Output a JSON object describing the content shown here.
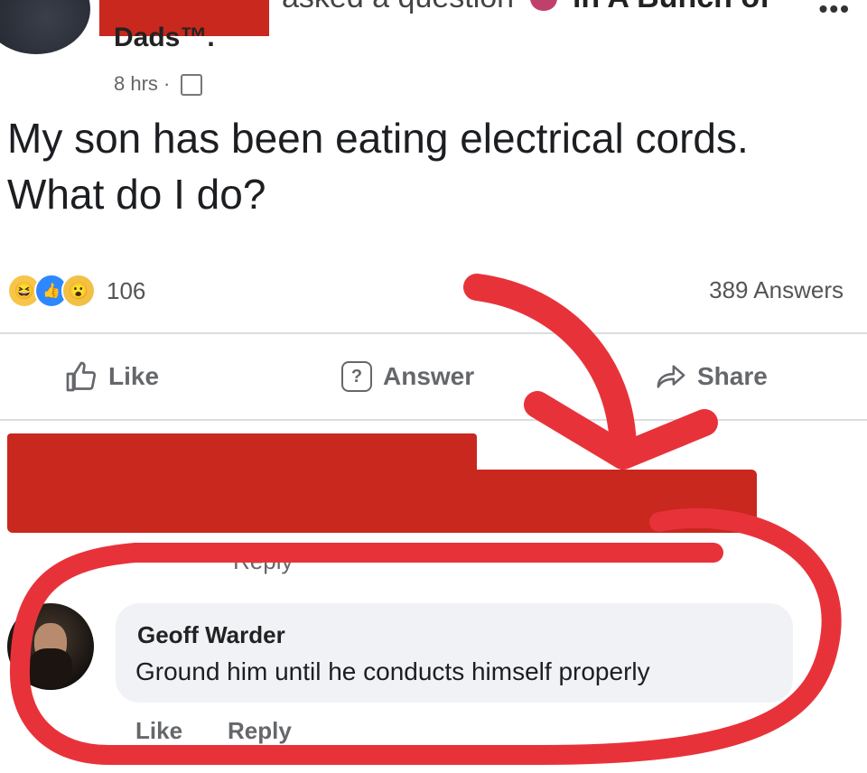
{
  "post": {
    "asked_text": "asked a question",
    "in_text": "in A Bunch of",
    "group_tail": "Dads™.",
    "time": "8 hrs ·",
    "question": "My son has been eating electrical cords. What do I do?",
    "reaction_count": "106",
    "answers_count": "389 Answers",
    "more": "•••"
  },
  "actions": {
    "like": "Like",
    "answer": "Answer",
    "share": "Share"
  },
  "partial": {
    "reply": "Reply"
  },
  "comment": {
    "author": "Geoff Warder",
    "text": "Ground him until he conducts himself properly",
    "like": "Like",
    "reply": "Reply"
  },
  "icons": {
    "reactions": [
      "haha-reaction-icon",
      "like-reaction-icon",
      "wow-reaction-icon"
    ],
    "like": "thumbs-up-icon",
    "answer": "question-bubble-icon",
    "share": "share-arrow-icon"
  },
  "colors": {
    "annotation_red": "#e8323a",
    "redaction_red": "#c8281e",
    "like_blue": "#2d88ff"
  }
}
